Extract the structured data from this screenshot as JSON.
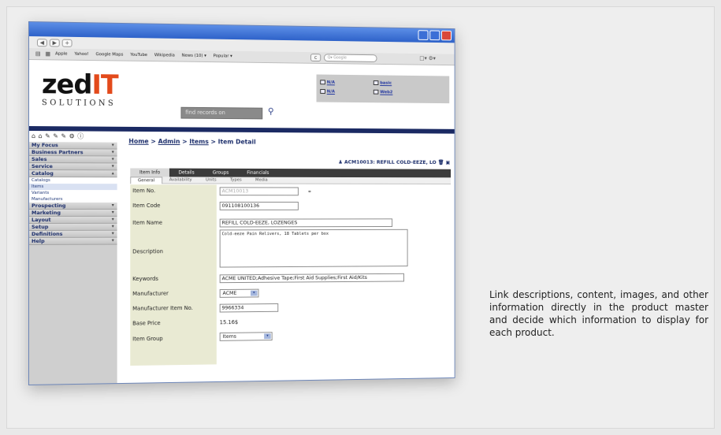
{
  "browser": {
    "bookmarks": [
      "Apple",
      "Yahoo!",
      "Google Maps",
      "YouTube",
      "Wikipedia",
      "News (10) ▾",
      "Popular ▾"
    ],
    "search_placeholder": "Q▾ Google"
  },
  "header": {
    "logo_main": "zed",
    "logo_accent": "IT",
    "logo_sub": "SOLUTIONS",
    "find_placeholder": "find records on",
    "user_links": [
      "N/A",
      "N/A",
      "basic",
      "Web2"
    ]
  },
  "sidebar": {
    "groups": [
      {
        "label": "My Focus"
      },
      {
        "label": "Business Partners"
      },
      {
        "label": "Sales"
      },
      {
        "label": "Service"
      },
      {
        "label": "Catalog"
      }
    ],
    "catalog_items": [
      "Catalogs",
      "Items",
      "Variants",
      "Manufacturers"
    ],
    "groups_after": [
      {
        "label": "Prospecting"
      },
      {
        "label": "Marketing"
      },
      {
        "label": "Layout"
      },
      {
        "label": "Setup"
      },
      {
        "label": "Definitions"
      },
      {
        "label": "Help"
      }
    ]
  },
  "content": {
    "breadcrumb": {
      "home": "Home",
      "admin": "Admin",
      "items": "Items",
      "current": "Item Detail",
      "sep": ">"
    },
    "record_title": "ACM10013: REFILL COLD-EEZE, LO",
    "tabs": [
      "Item Info",
      "Details",
      "Groups",
      "Financials"
    ],
    "subtabs": [
      "General",
      "Availability",
      "Units",
      "Types",
      "Media"
    ]
  },
  "form": {
    "item_no_label": "Item No.",
    "item_no_value": "ACM10013",
    "item_code_label": "Item Code",
    "item_code_value": "091108100136",
    "item_name_label": "Item Name",
    "item_name_value": "REFILL COLD-EEZE, LOZENGES",
    "description_label": "Description",
    "description_value": "Cold-eeze Pain Relivers, 18 Tablets per box",
    "keywords_label": "Keywords",
    "keywords_value": "ACME UNITED;Adhesive Tape;First Aid Supplies;First Aid/Kits",
    "manufacturer_label": "Manufacturer",
    "manufacturer_value": "ACME",
    "manufacturer_item_no_label": "Manufacturer Item No.",
    "manufacturer_item_no_value": "9966334",
    "base_price_label": "Base Price",
    "base_price_value": "15.16$",
    "item_group_label": "Item Group",
    "item_group_value": "Items"
  },
  "caption": "Link descriptions, content, images, and other information directly in the product master and decide which information to display for each product."
}
